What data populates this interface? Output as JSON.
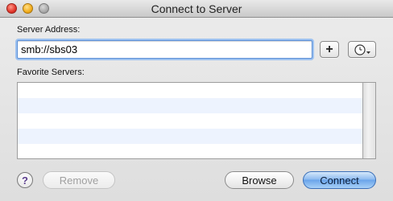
{
  "window": {
    "title": "Connect to Server"
  },
  "server_address": {
    "label": "Server Address:",
    "value": "smb://sbs03",
    "add_button_label": "+",
    "recent_icon": "clock-icon"
  },
  "favorites": {
    "label": "Favorite Servers:",
    "rows": [
      "",
      "",
      "",
      "",
      ""
    ]
  },
  "buttons": {
    "help_label": "?",
    "remove_label": "Remove",
    "browse_label": "Browse",
    "connect_label": "Connect"
  },
  "colors": {
    "accent": "#6aa4ea",
    "list_alt_row": "#edf3fe",
    "close": "#e2352a",
    "minimize": "#f2ad1c"
  }
}
